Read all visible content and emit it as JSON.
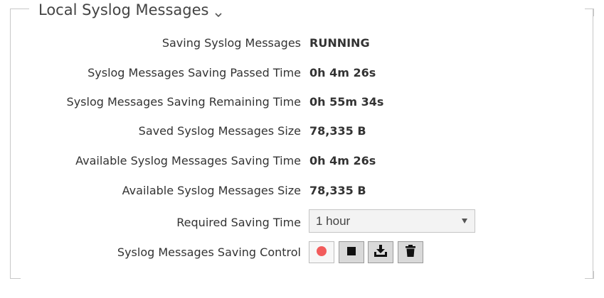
{
  "section": {
    "title": "Local Syslog Messages",
    "icon": "chevron-down-icon"
  },
  "fields": [
    {
      "label": "Saving Syslog Messages",
      "value": "RUNNING"
    },
    {
      "label": "Syslog Messages Saving Passed Time",
      "value": "0h 4m 26s"
    },
    {
      "label": "Syslog Messages Saving Remaining Time",
      "value": "0h 55m 34s"
    },
    {
      "label": "Saved Syslog Messages Size",
      "value": "78,335 B"
    },
    {
      "label": "Available Syslog Messages Saving Time",
      "value": "0h 4m 26s"
    },
    {
      "label": "Available Syslog Messages Size",
      "value": "78,335 B"
    }
  ],
  "required_saving_time": {
    "label": "Required Saving Time",
    "selected": "1 hour"
  },
  "control": {
    "label": "Syslog Messages Saving Control",
    "buttons": [
      {
        "name": "record",
        "icon": "record-icon",
        "color": "#f25c5c"
      },
      {
        "name": "stop",
        "icon": "stop-icon",
        "color": "#111111"
      },
      {
        "name": "download",
        "icon": "download-icon",
        "color": "#111111"
      },
      {
        "name": "delete",
        "icon": "trash-icon",
        "color": "#111111"
      }
    ]
  }
}
